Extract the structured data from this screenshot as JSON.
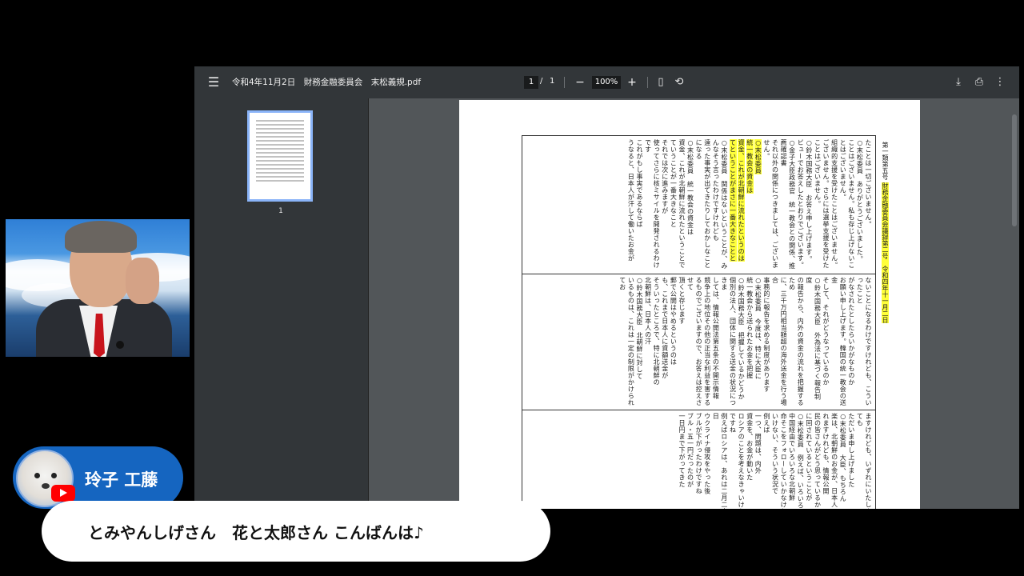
{
  "viewer": {
    "file_title": "令和4年11月2日　財務金融委員会　末松義規.pdf",
    "current_page": "1",
    "page_separator": "/",
    "total_pages": "1",
    "zoom": "100%",
    "thumbnail_label": "1",
    "icons": {
      "menu": "menu-icon",
      "zoom_out": "minus-icon",
      "zoom_in": "plus-icon",
      "fit": "fit-page-icon",
      "rotate": "rotate-icon",
      "download": "download-icon",
      "print": "print-icon",
      "more": "more-vert-icon"
    }
  },
  "document": {
    "page_side_label": "第一類第五号",
    "page_side_highlight": "財務金融委員会議録第二号　令和四年十一月二日",
    "columns_top": [
      "たことは一切ございません。",
      "○末松委員　ありがとうございました。",
      "ことはございません。私も存じ上げないことはございません。",
      "組織的支援を受けたことはございません。",
      "ございません。さらには選挙支援を受けたことはございません。",
      "○鈴木国務大臣　お答え申し上げます。",
      "ビューでお答えしたとおりでございます。",
      "○金子大臣政務官　統一教会との関係、推薦確認書",
      "それ以外の関係につきましては、ございません。",
      "○末松委員　関係はないということが、みんなそう言ったわけですけれども",
      "遠った事実が出てきたりしておかしなことになる",
      "○末松委員　統一教会の資金は",
      "資金、これが北朝鮮に流れたということで",
      "ていうことが一番大きなこと",
      "それでは次に進みますが",
      "使ってさらに核ミサイルを開発されるわけです",
      "これがもし事実であるならば",
      "うなると、日本人が汗して働いたお金が"
    ],
    "highlighted_phrases": [
      "○末松委員",
      "統一教会の資金は",
      "資金、これが北朝鮮に流れたというのは",
      "てということがまさに一番大きなことと"
    ],
    "columns_middle": [
      "ないことになるわけですけれども、こういったこと",
      "がなされたとしたらいかがなものか",
      "お願い申し上げます。韓国の統一教会の送金",
      "そして、それがどうなっているのか",
      "○鈴木国務大臣　外為法に基づく報告制度",
      "の報告から、内外の資金の流れを把握するため",
      "に、三千万円相当額超の海外送金を行う場合",
      "事務的に報告を求める制度があります",
      "○末松委員　今度は、特に大臣に",
      "統一教会から送られたお金を把握",
      "○鈴木国務大臣　把握しているかどうか",
      "個別の法人、団体に関する送金の状況につきま",
      "しては、情報公開法第五条の不開示情報",
      "競争上の地位その他の正当な利益を害する",
      "るものでございますので、お答えは控えさせて",
      "頂くと存じます",
      "郵で公開はやめるというのは",
      "も、これまで日本人に資額送金が",
      "そういったところで、特に北朝鮮の",
      "北朝鮮は、日本人の汗",
      "○鈴木国務大臣　北朝鮮に対して",
      "いるものは、これは一定の制限がかけられてお"
    ],
    "columns_bottom": [
      "ますけれども、いずれにいたしましても",
      "ただいま申し上げました",
      "○末松委員　大臣、もちろん",
      "楽は、北朝鮮のお金が、日本人",
      "れますけれども、情報公開",
      "民の皆さんがどう思っているか",
      "に回されているということが",
      "○末松委員　例えば、いろいろな",
      "中国経由でいろいろな北朝鮮",
      "命そこをフォローしていかなければ",
      "いけない、そういう状況で",
      "例えば",
      "一つ、問題は、内外",
      "資金を、お金が動いた",
      "ロシアのことを考えなきゃいけないですね",
      "例えばロシアは、あれは二月二十四日",
      "ウクライナ侵攻をやった後",
      "ブルが下がったわけですね",
      "ブル・五一円だったのが",
      "一日円まで下がってきた"
    ]
  },
  "stream": {
    "user_name": "玲子 工藤",
    "comment": "とみやんしげさん　花と太郎さん こんばんは♪",
    "youtube_icon": "youtube-icon",
    "avatar_icon": "dog-avatar-icon"
  },
  "colors": {
    "toolbar_bg": "#323639",
    "viewer_bg": "#525659",
    "highlight": "#ffff3a",
    "badge_blue": "#1565c0",
    "tie_red": "#c8141c"
  }
}
